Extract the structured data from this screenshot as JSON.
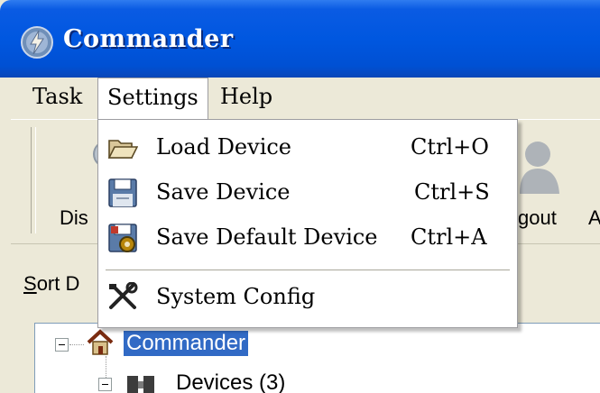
{
  "window": {
    "title": "Commander"
  },
  "menubar": {
    "items": [
      "Task",
      "Settings",
      "Help"
    ]
  },
  "toolbar": {
    "left_label": "Dis",
    "right_label": "gout",
    "edge_label": "A"
  },
  "panel": {
    "sort_prefix": "S",
    "sort_rest": "ort D"
  },
  "tree": {
    "root": "Commander",
    "child": "Devices (3)"
  },
  "settings_menu": {
    "items": [
      {
        "label": "Load Device",
        "shortcut": "Ctrl+O",
        "icon": "folder-open-icon"
      },
      {
        "label": "Save Device",
        "shortcut": "Ctrl+S",
        "icon": "floppy-disk-icon"
      },
      {
        "label": "Save Default Device",
        "shortcut": "Ctrl+A",
        "icon": "save-default-gear-icon"
      },
      {
        "label": "System Config",
        "shortcut": "",
        "icon": "tools-icon"
      }
    ]
  },
  "colors": {
    "titlebar": "#0057e0",
    "selection": "#316ac5",
    "menu_bg": "#ece9d8"
  }
}
